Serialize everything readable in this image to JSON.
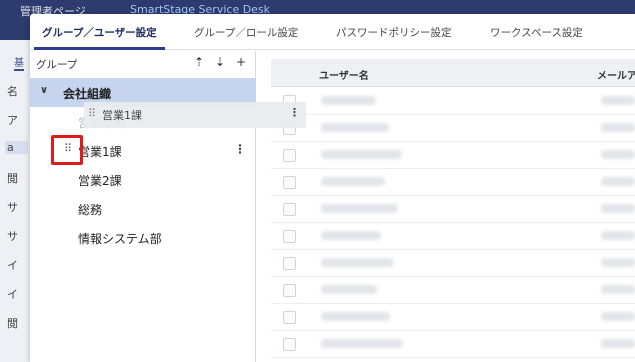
{
  "background": {
    "app_title": "管理者ページ",
    "app_name": "SmartStage Service Desk",
    "tab_stub": "基",
    "left_stubs": [
      "名",
      "ア",
      "a",
      "閲",
      "サ",
      "サ",
      "イ",
      "イ",
      "閲"
    ]
  },
  "tabs": [
    {
      "label": "グループ／ユーザー設定",
      "active": true
    },
    {
      "label": "グループ／ロール設定",
      "active": false
    },
    {
      "label": "パスワードポリシー設定",
      "active": false
    },
    {
      "label": "ワークスペース設定",
      "active": false
    }
  ],
  "group_panel": {
    "title": "グループ",
    "icons": [
      "upload-icon",
      "download-icon",
      "plus-icon"
    ],
    "icon_glyphs": [
      "⇡",
      "⇣",
      "+"
    ],
    "root": {
      "label": "会社組織",
      "chevron": "∨"
    },
    "children": [
      {
        "label": "営業本部",
        "state": "drag-origin"
      },
      {
        "label": "営業1課",
        "state": "hovered",
        "handle": "⠿",
        "menu": "⋮"
      },
      {
        "label": "営業2課"
      },
      {
        "label": "総務"
      },
      {
        "label": "情報システム部"
      }
    ]
  },
  "drag_ghost": {
    "label": "営業1課",
    "handle": "⠿",
    "menu": "⋮"
  },
  "table": {
    "columns": [
      "ユーザー名",
      "メールアド"
    ],
    "row_count": 10
  },
  "colors": {
    "accent": "#2d3b8f",
    "root_highlight": "#c7d4ee",
    "annotation_red": "#e01b1b"
  }
}
